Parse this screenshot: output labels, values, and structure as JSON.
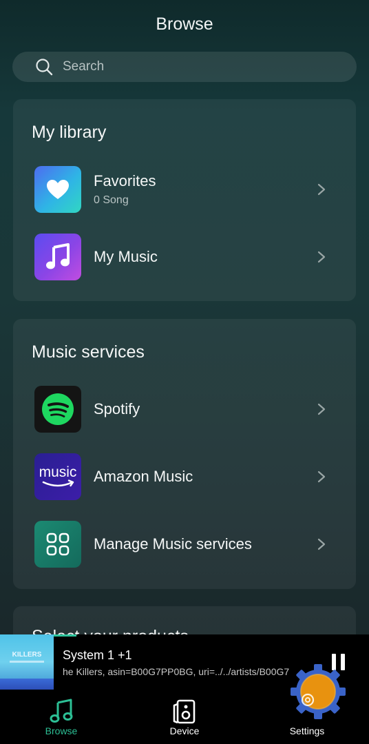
{
  "header": {
    "title": "Browse"
  },
  "search": {
    "placeholder": "Search"
  },
  "my_library": {
    "title": "My library",
    "items": [
      {
        "label": "Favorites",
        "sub": "0  Song",
        "icon": "heart-icon"
      },
      {
        "label": "My Music",
        "sub": "",
        "icon": "music-note-icon"
      }
    ]
  },
  "music_services": {
    "title": "Music services",
    "items": [
      {
        "label": "Spotify",
        "icon": "spotify-icon"
      },
      {
        "label": "Amazon Music",
        "icon": "amazon-music-icon",
        "icon_text": "music"
      },
      {
        "label": "Manage Music services",
        "icon": "grid-icon"
      }
    ]
  },
  "partial_card": {
    "title": "Select your products"
  },
  "now_playing": {
    "album_text": "KILLERS",
    "title": "System 1  +1",
    "subtitle": "he Killers, asin=B00G7PP0BG, uri=../../artists/B00G7",
    "progress": 0.06
  },
  "tabs": [
    {
      "label": "Browse",
      "icon": "music-note-icon",
      "active": true
    },
    {
      "label": "Device",
      "icon": "speaker-icon",
      "active": false
    },
    {
      "label": "Settings",
      "icon": "gear-icon",
      "active": false
    }
  ],
  "colors": {
    "accent": "#2cbf95",
    "spotify_green": "#1ed760"
  }
}
